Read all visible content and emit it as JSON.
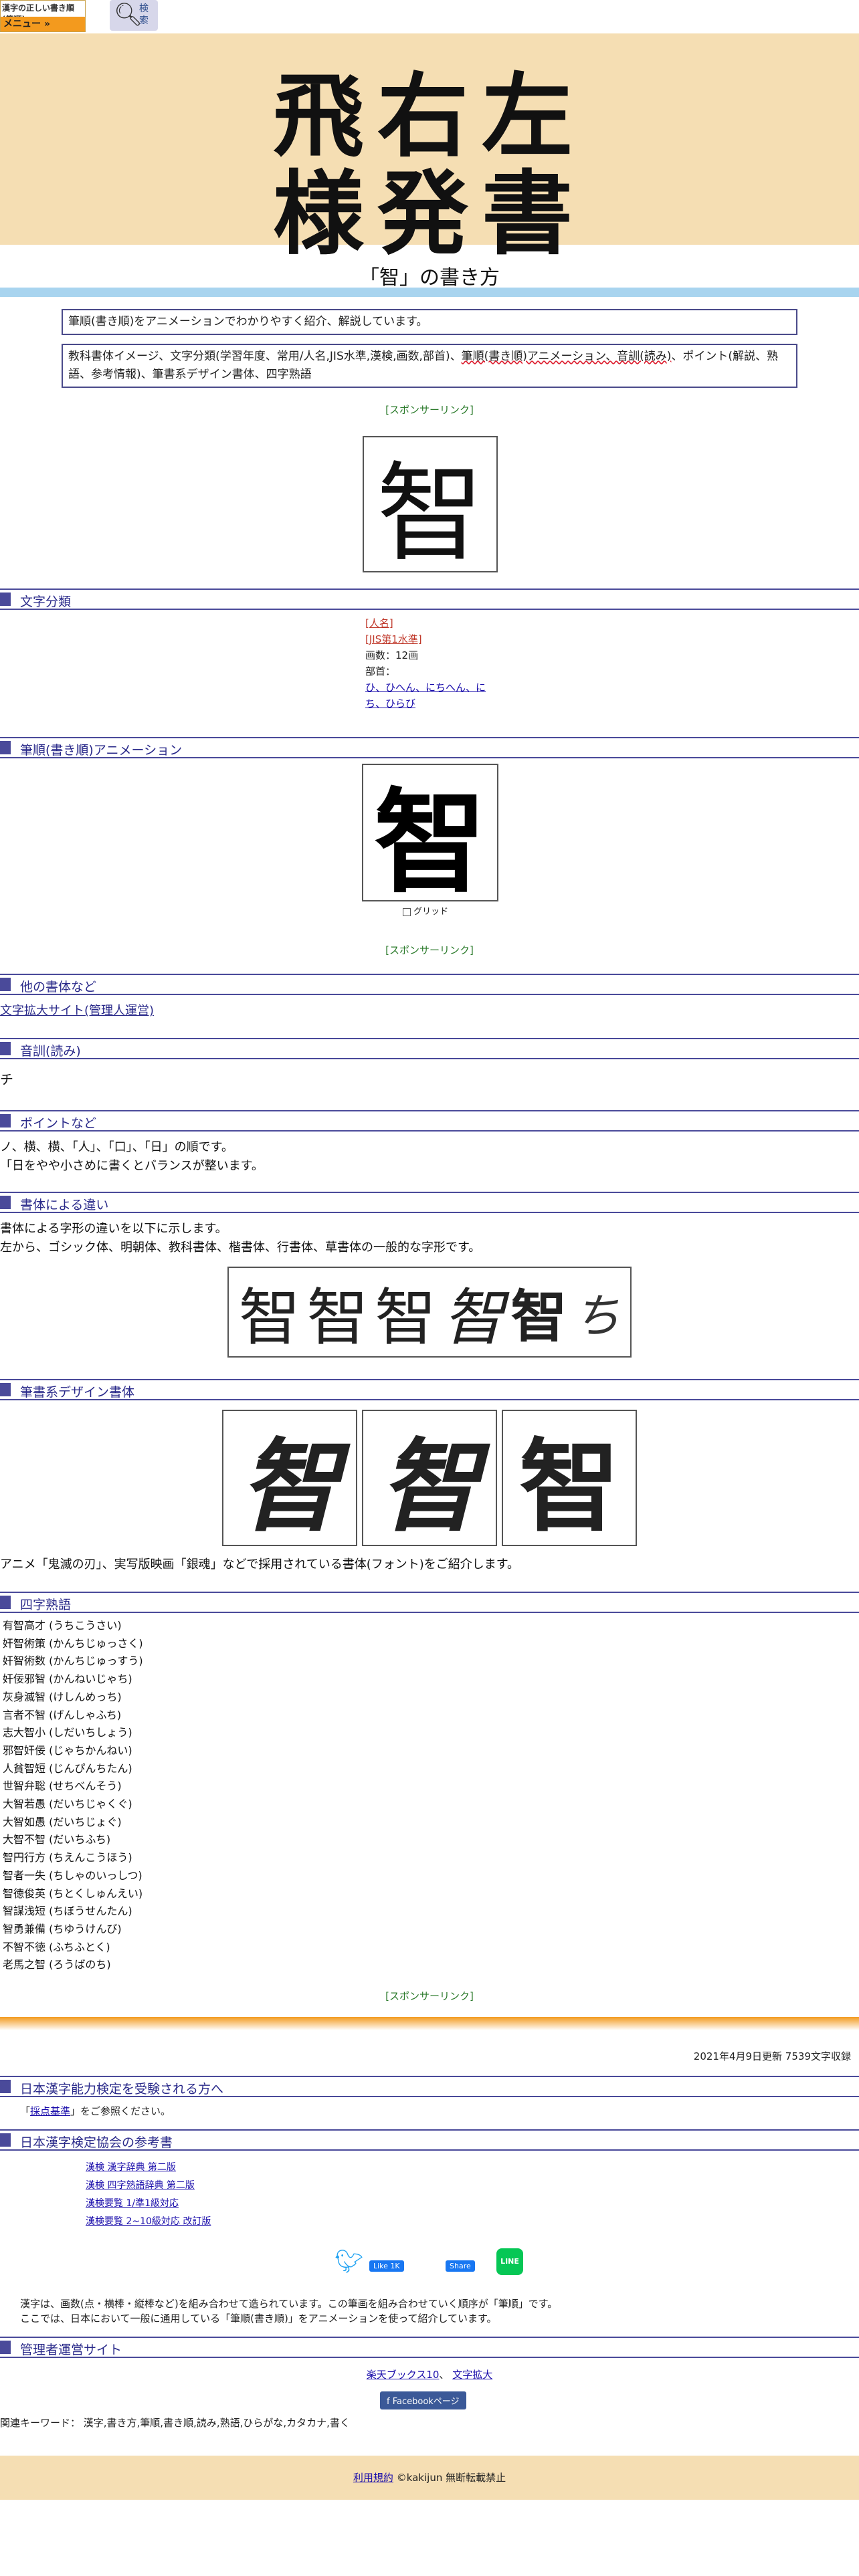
{
  "header": {
    "site_title": "漢字の正しい書き順(筆順)",
    "menu_label": "メニュー »",
    "search_label": "検索",
    "hero_row1": "飛右左",
    "hero_row2": "様発書"
  },
  "page": {
    "title": "「智」の書き方",
    "desc1": "筆順(書き順)をアニメーションでわかりやすく紹介、解説しています。",
    "desc2_a": "教科書体イメージ、文字分類(学習年度、常用/人名,JIS水準,漢検,画数,部首)、",
    "desc2_link": "筆順(書き順)アニメーション、音訓(読み)",
    "desc2_b": "、ポイント(解説、熟語、参考情報)、筆書系デザイン書体、四字熟語",
    "sponsor": "[スポンサーリンク]",
    "kanji": "智"
  },
  "sections": {
    "bunrui": "文字分類",
    "animation": "筆順(書き順)アニメーション",
    "other_fonts": "他の書体など",
    "onkun": "音訓(読み)",
    "point": "ポイントなど",
    "shotai": "書体による違い",
    "design": "筆書系デザイン書体",
    "yoji": "四字熟語",
    "kentei": "日本漢字能力検定を受験される方へ",
    "kyokai": "日本漢字検定協会の参考書",
    "admin": "管理者運営サイト"
  },
  "bunrui": {
    "jinmei": "[人名]",
    "jis": "[JIS第1水準]",
    "kakusu": "画数：12画",
    "bushu_label": "部首：",
    "bushu_value": "ひ、ひへん、にちへん、にち、ひらび"
  },
  "animation": {
    "grid_label": "グリッド"
  },
  "other": {
    "link": "文字拡大サイト(管理人運営)"
  },
  "onkun": {
    "reading": "チ"
  },
  "point": {
    "line1": "ノ、横、横、「人」、「口」、「日」の順です。",
    "line2": "「日をやや小さめに書くとバランスが整います。"
  },
  "shotai": {
    "line1": "書体による字形の違いを以下に示します。",
    "line2": "左から、ゴシック体、明朝体、教科書体、楷書体、行書体、草書体の一般的な字形です。",
    "samples": [
      "智",
      "智",
      "智",
      "智",
      "智",
      "ち"
    ]
  },
  "design": {
    "caption": "アニメ「鬼滅の刃」、実写版映画「銀魂」などで採用されている書体(フォント)をご紹介します。"
  },
  "yoji": [
    "有智高才 (うちこうさい)",
    "奸智術策 (かんちじゅっさく)",
    "奸智術数 (かんちじゅっすう)",
    "奸佞邪智 (かんねいじゃち)",
    "灰身滅智 (けしんめっち)",
    "言者不智 (げんしゃふち)",
    "志大智小 (しだいちしょう)",
    "邪智奸佞 (じゃちかんねい)",
    "人貧智短 (じんぴんちたん)",
    "世智弁聡 (せちべんそう)",
    "大智若愚 (だいちじゃくぐ)",
    "大智如愚 (だいちじょぐ)",
    "大智不智 (だいちふち)",
    "智円行方 (ちえんこうほう)",
    "智者一失 (ちしゃのいっしつ)",
    "智徳俊英 (ちとくしゅんえい)",
    "智謀浅短 (ちぼうせんたん)",
    "智勇兼備 (ちゆうけんび)",
    "不智不徳 (ふちふとく)",
    "老馬之智 (ろうばのち)"
  ],
  "footer": {
    "updated": "2021年4月9日更新 7539文字収録",
    "kentei_link": "採点基準",
    "kentei_text": "をご参照ください。",
    "books": [
      "漢検 漢字辞典 第二版",
      "漢検 四字熟語辞典 第二版",
      "漢検要覧 1/準1級対応",
      "漢検要覧 2~10級対応 改訂版"
    ],
    "like": "Like 1K",
    "share": "Share",
    "note1": "漢字は、画数(点・横棒・縦棒など)を組み合わせて造られています。この筆画を組み合わせていく順序が「筆順」です。",
    "note2": "ここでは、日本において一般に通用している「筆順(書き順)」をアニメーションを使って紹介しています。",
    "admin_link1": "楽天ブックス10",
    "admin_link2": "文字拡大",
    "fb_page": "Facebookページ",
    "keywords": "関連キーワード： 漢字,書き方,筆順,書き順,読み,熟語,ひらがな,カタカナ,書く",
    "terms": "利用規約",
    "copyright": "©kakijun 無断転載禁止"
  }
}
